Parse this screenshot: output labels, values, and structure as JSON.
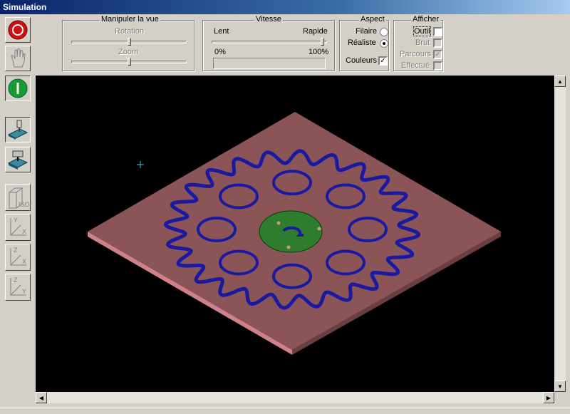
{
  "window": {
    "title": "Simulation"
  },
  "toolbar": {
    "buttons": [
      {
        "name": "stop-button",
        "icon": "stop-red-circle-icon"
      },
      {
        "name": "hand-pan-button",
        "icon": "hand-icon"
      },
      {
        "name": "start-button",
        "icon": "start-green-circle-icon"
      },
      {
        "name": "machine-view-button",
        "icon": "machine-tool-icon"
      },
      {
        "name": "machine-3d-button",
        "icon": "machine-3d-icon"
      },
      {
        "name": "iso-view-button",
        "icon": "iso-cube-icon",
        "label": "ISO"
      },
      {
        "name": "view-xy-button",
        "icon": "axis-xy-icon"
      },
      {
        "name": "view-xz-button",
        "icon": "axis-xz-icon"
      },
      {
        "name": "view-yz-button",
        "icon": "axis-yz-icon"
      }
    ]
  },
  "view_panel": {
    "title": "Manipuler la vue",
    "rotation_label": "Rotation",
    "zoom_label": "Zoom",
    "rotation_value": 0.5,
    "zoom_value": 0.5
  },
  "speed_panel": {
    "title": "Vitesse",
    "slow_label": "Lent",
    "fast_label": "Rapide",
    "speed_value": 1.0,
    "progress_min_label": "0%",
    "progress_max_label": "100%",
    "progress_value": 0
  },
  "aspect_panel": {
    "title": "Aspect",
    "wireframe_label": "Filaire",
    "realistic_label": "Réaliste",
    "colors_label": "Couleurs",
    "selected": "realistic",
    "colors_checked": true
  },
  "display_panel": {
    "title": "Afficher",
    "tool_label": "Outil",
    "raw_label": "Brut",
    "path_label": "Parcours",
    "done_label": "Effectué",
    "tool_checked": false,
    "raw_checked": false,
    "path_checked": true,
    "done_checked": false
  },
  "scene": {
    "plate_color": "#8b5558",
    "groove_color": "#1a1aa0",
    "hub_color": "#2e7d2e",
    "background": "#000000",
    "gear_teeth": 24,
    "holes": 8
  },
  "scroll": {
    "up_arrow": "▲",
    "down_arrow": "▼",
    "left_arrow": "◀",
    "right_arrow": "▶"
  }
}
